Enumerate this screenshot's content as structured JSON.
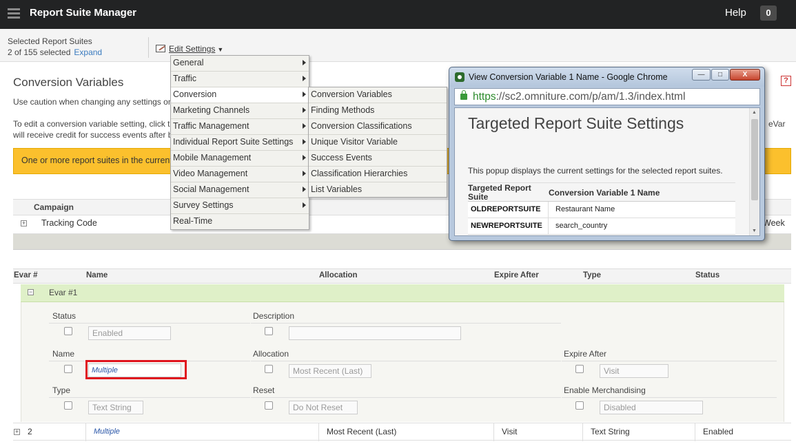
{
  "header": {
    "app_title": "Report Suite Manager",
    "help_label": "Help",
    "notification_count": "0"
  },
  "subheader": {
    "selected_label": "Selected Report Suites",
    "selected_count": "2 of 155 selected",
    "expand_label": "Expand",
    "edit_settings_label": "Edit Settings"
  },
  "page": {
    "title": "Conversion Variables",
    "caution_text": "Use caution when changing any settings on",
    "edit_help_1": "To edit a conversion variable setting, click t",
    "edit_help_2": "will receive credit for success events after b",
    "evar_fragment": "eVar",
    "warning_text": "One or more report suites in the current s"
  },
  "campaign": {
    "header": "Campaign",
    "plus": "+",
    "tracking_code": "Tracking Code",
    "week_fragment": "Week"
  },
  "menu1": {
    "items": [
      {
        "label": "General",
        "submenu": true
      },
      {
        "label": "Traffic",
        "submenu": true
      },
      {
        "label": "Conversion",
        "submenu": true
      },
      {
        "label": "Marketing Channels",
        "submenu": true
      },
      {
        "label": "Traffic Management",
        "submenu": true
      },
      {
        "label": "Individual Report Suite Settings",
        "submenu": true
      },
      {
        "label": "Mobile Management",
        "submenu": true
      },
      {
        "label": "Video Management",
        "submenu": true
      },
      {
        "label": "Social Management",
        "submenu": true
      },
      {
        "label": "Survey Settings",
        "submenu": true
      },
      {
        "label": "Real-Time",
        "submenu": false
      }
    ]
  },
  "menu2": {
    "items": [
      {
        "label": "Conversion Variables"
      },
      {
        "label": "Finding Methods"
      },
      {
        "label": "Conversion Classifications"
      },
      {
        "label": "Unique Visitor Variable"
      },
      {
        "label": "Success Events"
      },
      {
        "label": "Classification Hierarchies"
      },
      {
        "label": "List Variables"
      }
    ]
  },
  "popup": {
    "window_title": "View Conversion Variable 1 Name - Google Chrome",
    "minimize": "—",
    "maximize": "□",
    "close": "X",
    "url_scheme": "https",
    "url_rest": "://sc2.omniture.com/p/am/1.3/index.html",
    "heading": "Targeted Report Suite Settings",
    "description": "This popup displays the current settings for the selected report suites.",
    "col1_header": "Targeted Report Suite",
    "col2_header": "Conversion Variable 1 Name",
    "rows": [
      {
        "suite": "OLDREPORTSUITE",
        "value": "Restaurant Name"
      },
      {
        "suite": "NEWREPORTSUITE",
        "value": "search_country"
      }
    ],
    "scroll_up": "▲",
    "scroll_down": "▼"
  },
  "evar_table": {
    "columns": {
      "evar": "Evar #",
      "name": "Name",
      "allocation": "Allocation",
      "expire": "Expire After",
      "type": "Type",
      "status": "Status"
    },
    "evar1": {
      "minus": "−",
      "label": "Evar #1",
      "status_label": "Status",
      "status_value": "Enabled",
      "description_label": "Description",
      "description_value": "",
      "name_label": "Name",
      "name_value": "Multiple",
      "allocation_label": "Allocation",
      "allocation_value": "Most Recent (Last)",
      "expire_label": "Expire After",
      "expire_value": "Visit",
      "type_label": "Type",
      "type_value": "Text String",
      "reset_label": "Reset",
      "reset_value": "Do Not Reset",
      "merch_label": "Enable Merchandising",
      "merch_value": "Disabled"
    },
    "row2": {
      "plus": "+",
      "number": "2",
      "name": "Multiple",
      "allocation": "Most Recent (Last)",
      "expire": "Visit",
      "type": "Text String",
      "status": "Enabled"
    }
  },
  "colors": {
    "topbar": "#222324",
    "warning": "#fbc02d",
    "evar_highlight": "#dff0c8",
    "link": "#3a7bbf",
    "red_outline": "#e0141e"
  }
}
